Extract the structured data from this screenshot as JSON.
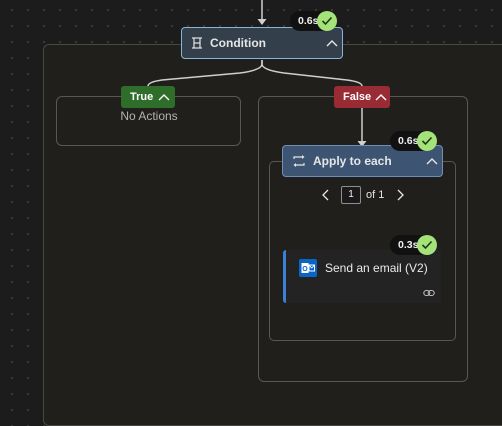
{
  "condition": {
    "title": "Condition",
    "duration": "0.6s"
  },
  "true_branch": {
    "label": "True",
    "empty_text": "No Actions"
  },
  "false_branch": {
    "label": "False"
  },
  "apply_to_each": {
    "title": "Apply to each",
    "duration": "0.6s",
    "pager": {
      "current": "1",
      "of_text": "of 1"
    }
  },
  "send_email": {
    "title": "Send an email (V2)",
    "duration": "0.3s"
  },
  "colors": {
    "true_green": "#2f6d2a",
    "false_red": "#982b34",
    "success": "#a4e27a",
    "accent_blue": "#3b82d6"
  },
  "icons": [
    "condition-icon",
    "chevron-up-icon",
    "checkmark-icon",
    "loop-icon",
    "chevron-left-icon",
    "chevron-right-icon",
    "outlook-icon",
    "link-icon"
  ]
}
